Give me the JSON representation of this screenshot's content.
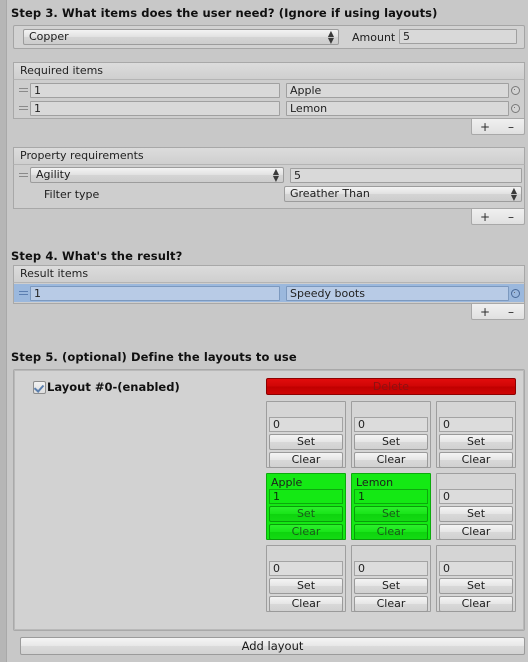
{
  "steps": {
    "step3_title": "Step 3. What items does the user need? (Ignore if using layouts)",
    "step4_title": "Step 4. What's the result?",
    "step5_title": "Step 5. (optional) Define the layouts to use"
  },
  "crafting_item": {
    "item_dropdown": "Copper",
    "amount_label": "Amount",
    "amount_value": "5"
  },
  "required_items": {
    "header": "Required items",
    "rows": [
      {
        "amount": "1",
        "item": "Apple"
      },
      {
        "amount": "1",
        "item": "Lemon"
      }
    ],
    "add_label": "+",
    "remove_label": "–"
  },
  "property_requirements": {
    "header": "Property requirements",
    "property": "Agility",
    "value": "5",
    "filter_type_label": "Filter type",
    "filter_type_value": "Greather Than",
    "add_label": "+",
    "remove_label": "–"
  },
  "result_items": {
    "header": "Result items",
    "rows": [
      {
        "amount": "1",
        "item": "Speedy boots",
        "selected": true
      }
    ],
    "add_label": "+",
    "remove_label": "–"
  },
  "layout": {
    "enabled": true,
    "label": "Layout #0-(enabled)",
    "delete_label": "Delete",
    "set_label": "Set",
    "clear_label": "Clear",
    "slots": [
      {
        "name": "",
        "amount": "0",
        "filled": false
      },
      {
        "name": "",
        "amount": "0",
        "filled": false
      },
      {
        "name": "",
        "amount": "0",
        "filled": false
      },
      {
        "name": "Apple",
        "amount": "1",
        "filled": true
      },
      {
        "name": "Lemon",
        "amount": "1",
        "filled": true
      },
      {
        "name": "",
        "amount": "0",
        "filled": false
      },
      {
        "name": "",
        "amount": "0",
        "filled": false
      },
      {
        "name": "",
        "amount": "0",
        "filled": false
      },
      {
        "name": "",
        "amount": "0",
        "filled": false
      }
    ],
    "add_layout_label": "Add layout"
  },
  "colors": {
    "background": "#c8c8c8",
    "selection_blue": "#9bb8dd",
    "delete_red": "#d00606",
    "slot_green": "#14e914"
  }
}
